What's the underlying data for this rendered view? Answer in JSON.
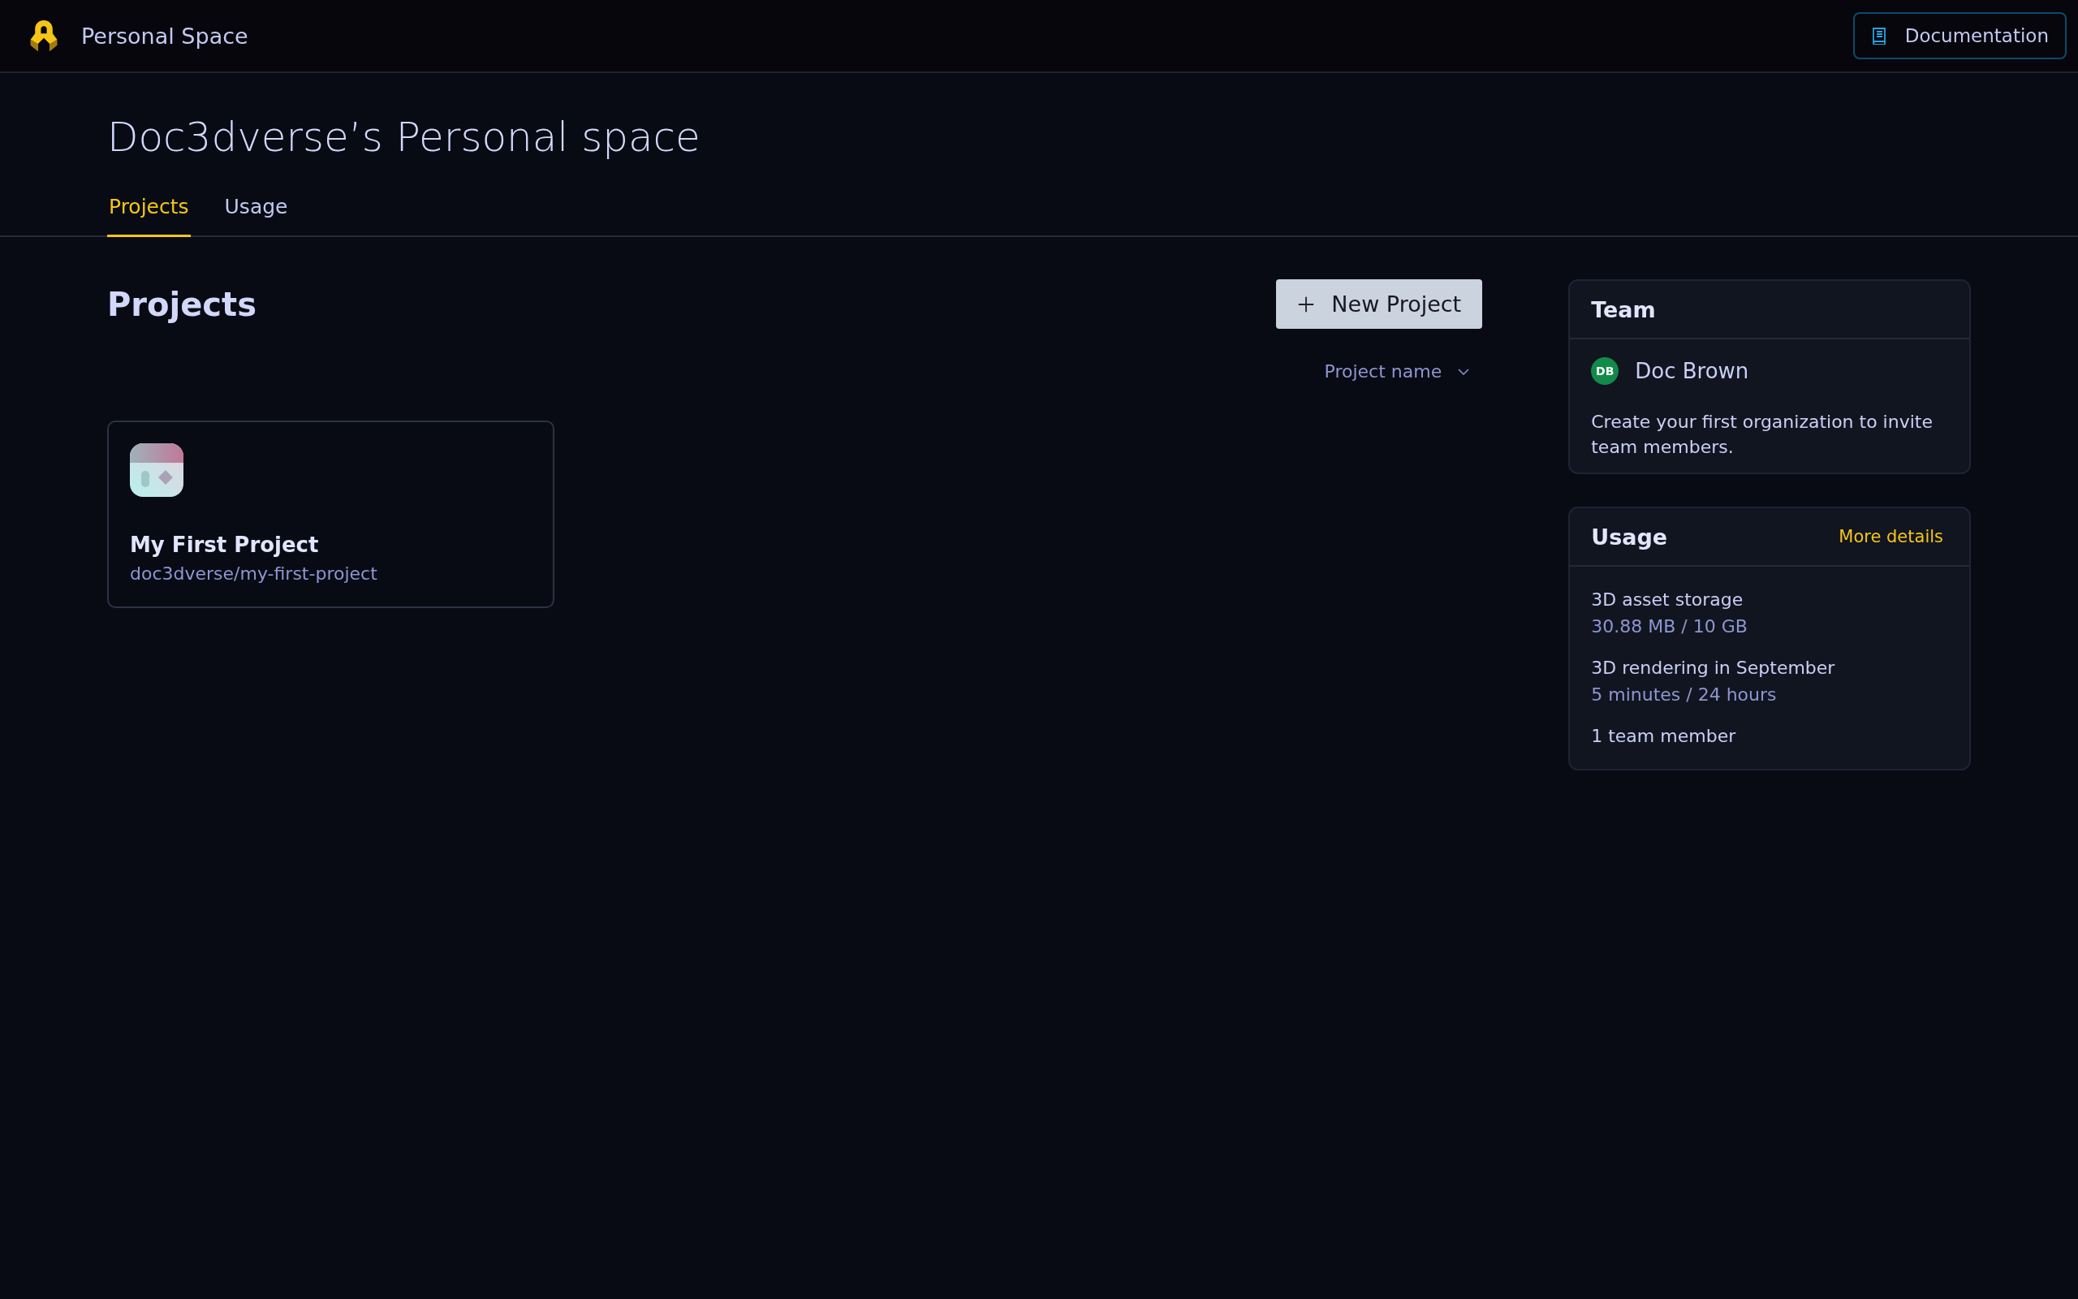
{
  "topbar": {
    "title": "Personal Space",
    "documentation_button": "Documentation"
  },
  "page_title": "Doc3dverse’s Personal space",
  "tabs": [
    {
      "label": "Projects",
      "selected": true
    },
    {
      "label": "Usage",
      "selected": false
    }
  ],
  "projects": {
    "heading": "Projects",
    "new_button": "New Project",
    "sort": {
      "label": "Project name"
    },
    "cards": [
      {
        "name": "My First Project",
        "path": "doc3dverse/my-first-project"
      }
    ]
  },
  "team": {
    "heading": "Team",
    "members": [
      {
        "initials": "DB",
        "name": "Doc Brown"
      }
    ],
    "note": "Create your first organization to invite team members."
  },
  "usage": {
    "heading": "Usage",
    "link": "More details",
    "items": [
      {
        "label": "3D asset storage",
        "value": "30.88 MB / 10 GB"
      },
      {
        "label": "3D rendering in September",
        "value": "5 minutes / 24 hours"
      },
      {
        "label": "1 team member"
      }
    ]
  }
}
